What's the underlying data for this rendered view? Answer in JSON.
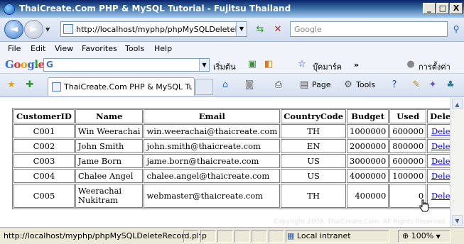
{
  "window": {
    "title": "ThaiCreate.Com PHP & MySQL Tutorial - Fujitsu Thailand",
    "minimize": "_",
    "maximize": "□",
    "close": "X"
  },
  "address": {
    "url": "http://localhost/myphp/phpMySQLDeleteRecord",
    "search_placeholder": "Google"
  },
  "menu": [
    "File",
    "Edit",
    "View",
    "Favorites",
    "Tools",
    "Help"
  ],
  "google_toolbar": {
    "logo": "Google",
    "start_label": "เริ่มต้น",
    "bookmarks_label": "บุ๊คมาร์ค",
    "settings_label": "การตั้งค่า"
  },
  "tabbar": {
    "tab_title": "ThaiCreate.Com PHP & MySQL Tut...",
    "page_label": "Page",
    "tools_label": "Tools"
  },
  "table": {
    "headers": [
      "CustomerID",
      "Name",
      "Email",
      "CountryCode",
      "Budget",
      "Used",
      "Delete"
    ],
    "rows": [
      {
        "id": "C001",
        "name": "Win Weerachai",
        "email": "win.weerachai@thaicreate.com",
        "country": "TH",
        "budget": "1000000",
        "used": "600000",
        "delete": "Delete"
      },
      {
        "id": "C002",
        "name": "John Smith",
        "email": "john.smith@thaicreate.com",
        "country": "EN",
        "budget": "2000000",
        "used": "800000",
        "delete": "Delete"
      },
      {
        "id": "C003",
        "name": "Jame Born",
        "email": "jame.born@thaicreate.com",
        "country": "US",
        "budget": "3000000",
        "used": "600000",
        "delete": "Delete"
      },
      {
        "id": "C004",
        "name": "Chalee Angel",
        "email": "chalee.angel@thaicreate.com",
        "country": "US",
        "budget": "4000000",
        "used": "100000",
        "delete": "Delete"
      },
      {
        "id": "C005",
        "name": "Weerachai Nukitram",
        "email": "webmaster@thaicreate.com",
        "country": "TH",
        "budget": "400000",
        "used": "0",
        "delete": "Delete"
      }
    ]
  },
  "watermark": "Copyright 2009. ThaiCreate.Com. All Rights Reserved.",
  "status": {
    "text": "http://localhost/myphp/phpMySQLDeleteRecord.php",
    "zone": "Local intranet",
    "zoom": "100%"
  },
  "colors": {
    "link": "#0000ee",
    "titlebar": "#0a246a"
  }
}
